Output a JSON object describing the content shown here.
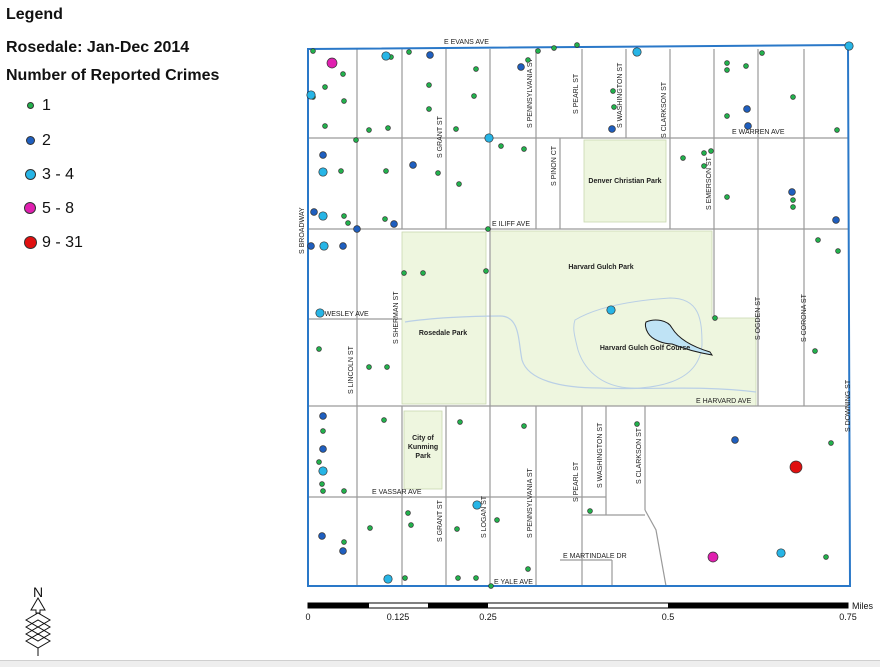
{
  "legend": {
    "title": "Legend",
    "subtitle": "Rosedale: Jan-Dec 2014",
    "measure": "Number of Reported Crimes",
    "classes": [
      {
        "label": "1",
        "color": "#22b14c"
      },
      {
        "label": "2",
        "color": "#1f5fbf"
      },
      {
        "label": "3 - 4",
        "color": "#27b5e6"
      },
      {
        "label": "5 - 8",
        "color": "#e020b0"
      },
      {
        "label": "9 - 31",
        "color": "#e01010"
      }
    ]
  },
  "map": {
    "streets": {
      "evans": "E EVANS AVE",
      "warren": "E WARREN AVE",
      "iliff": "E ILIFF AVE",
      "wesley": "E WESLEY AVE",
      "harvard": "E HARVARD AVE",
      "vassar": "E VASSAR AVE",
      "yale": "E YALE AVE",
      "martindale": "E MARTINDALE DR",
      "broadway": "S BROADWAY",
      "lincoln": "S LINCOLN ST",
      "sherman": "S SHERMAN ST",
      "grant_n": "S GRANT ST",
      "grant_s": "S GRANT ST",
      "logan": "S LOGAN ST",
      "penn_n": "S PENNSYLVANIA ST",
      "penn_s": "S PENNSYLVANIA ST",
      "pinon": "S PINON CT",
      "pearl_n": "S PEARL ST",
      "pearl_s": "S PEARL ST",
      "washington_n": "S WASHINGTON ST",
      "washington_s": "S WASHINGTON ST",
      "clarkson_n": "S CLARKSON ST",
      "clarkson_s": "S CLARKSON ST",
      "emerson": "S EMERSON ST",
      "ogden": "S OGDEN ST",
      "corona": "S CORONA ST",
      "downing": "S DOWNING ST"
    },
    "parks": {
      "denver_christian": "Denver Christian Park",
      "harvard_gulch": "Harvard Gulch Park",
      "golf": "Harvard Gulch Golf Course",
      "rosedale": "Rosedale Park",
      "kunming_1": "City of",
      "kunming_2": "Kunming",
      "kunming_3": "Park"
    },
    "north": "N",
    "scale_bar": {
      "unit": "Miles",
      "ticks": [
        "0",
        "0.125",
        "0.25",
        "0.5",
        "0.75"
      ]
    }
  },
  "colors": {
    "boundary": "#2a78c8",
    "street": "#9a9a9a",
    "park": "#eef6df",
    "water": "#bfe3f5",
    "creek": "#b9cfe6"
  }
}
